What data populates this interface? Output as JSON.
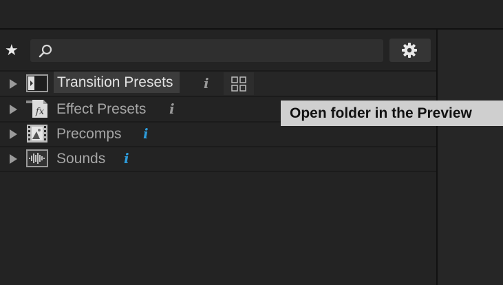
{
  "toolbar": {
    "favorites_icon": "star-icon",
    "search": {
      "icon": "search-icon",
      "placeholder": ""
    },
    "settings_icon": "gear-icon"
  },
  "tree": {
    "items": [
      {
        "label": "Transition Presets",
        "icon": "transition-preset-icon",
        "selected": true,
        "info_color": "#9a9a9a"
      },
      {
        "label": "Effect Presets",
        "icon": "effect-fx-icon",
        "selected": false,
        "info_color": "#9a9a9a"
      },
      {
        "label": "Precomps",
        "icon": "precomp-film-icon",
        "selected": false,
        "info_color": "#2d9cdb"
      },
      {
        "label": "Sounds",
        "icon": "waveform-icon",
        "selected": false,
        "info_color": "#2d9cdb"
      }
    ],
    "info_glyph": "i",
    "grid_button_icon": "grid-view-icon"
  },
  "tooltip": {
    "text": "Open folder in the Preview"
  },
  "colors": {
    "background": "#232323",
    "accent": "#2d9cdb",
    "tooltip_bg": "#cfcfcf"
  }
}
